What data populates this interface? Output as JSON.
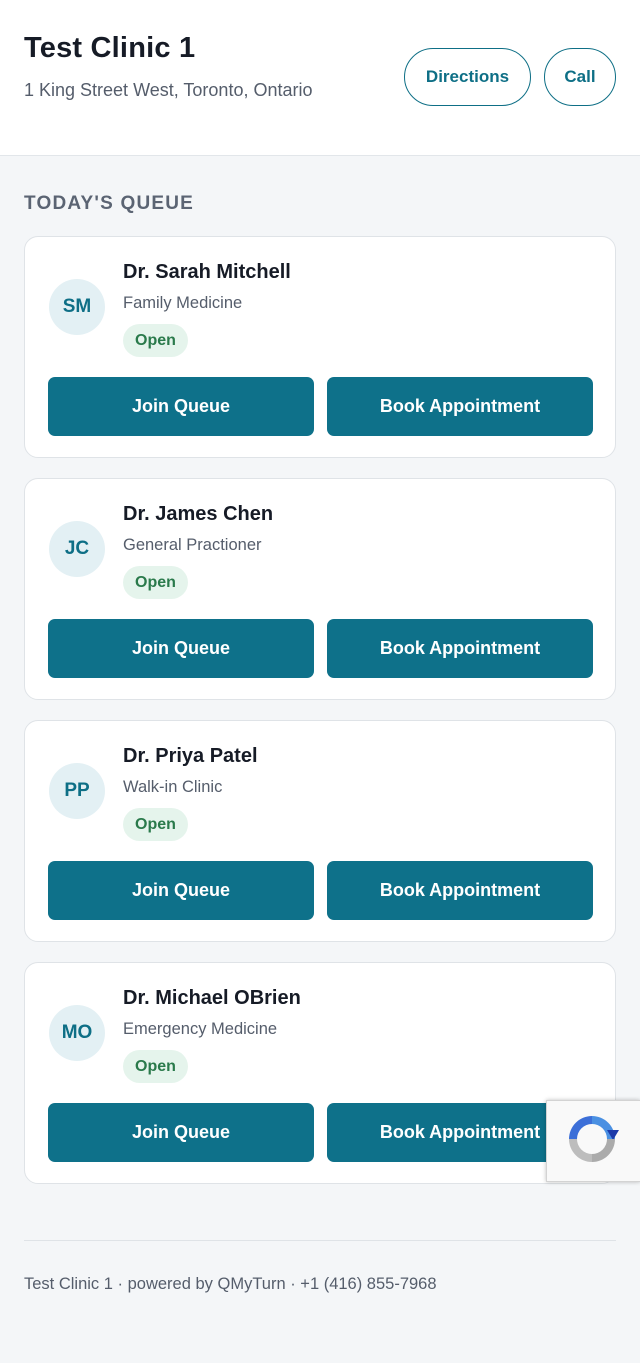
{
  "header": {
    "clinic_name": "Test Clinic 1",
    "address": "1 King Street West, Toronto, Ontario",
    "directions_label": "Directions",
    "call_label": "Call"
  },
  "queue": {
    "section_title": "TODAY'S QUEUE",
    "doctors": [
      {
        "initials": "SM",
        "name": "Dr. Sarah Mitchell",
        "specialty": "Family Medicine",
        "status": "Open",
        "join_label": "Join Queue",
        "book_label": "Book Appointment"
      },
      {
        "initials": "JC",
        "name": "Dr. James Chen",
        "specialty": "General Practioner",
        "status": "Open",
        "join_label": "Join Queue",
        "book_label": "Book Appointment"
      },
      {
        "initials": "PP",
        "name": "Dr. Priya Patel",
        "specialty": "Walk-in Clinic",
        "status": "Open",
        "join_label": "Join Queue",
        "book_label": "Book Appointment"
      },
      {
        "initials": "MO",
        "name": "Dr. Michael OBrien",
        "specialty": "Emergency Medicine",
        "status": "Open",
        "join_label": "Join Queue",
        "book_label": "Book Appointment"
      }
    ]
  },
  "footer": {
    "text": "Test Clinic 1 · powered by QMyTurn · +1 (416) 855-7968"
  },
  "icons": {
    "recaptcha": "recaptcha-icon"
  },
  "colors": {
    "primary": "#0e718a",
    "status_open_bg": "#e5f4ec",
    "status_open_text": "#2a7a4b"
  }
}
